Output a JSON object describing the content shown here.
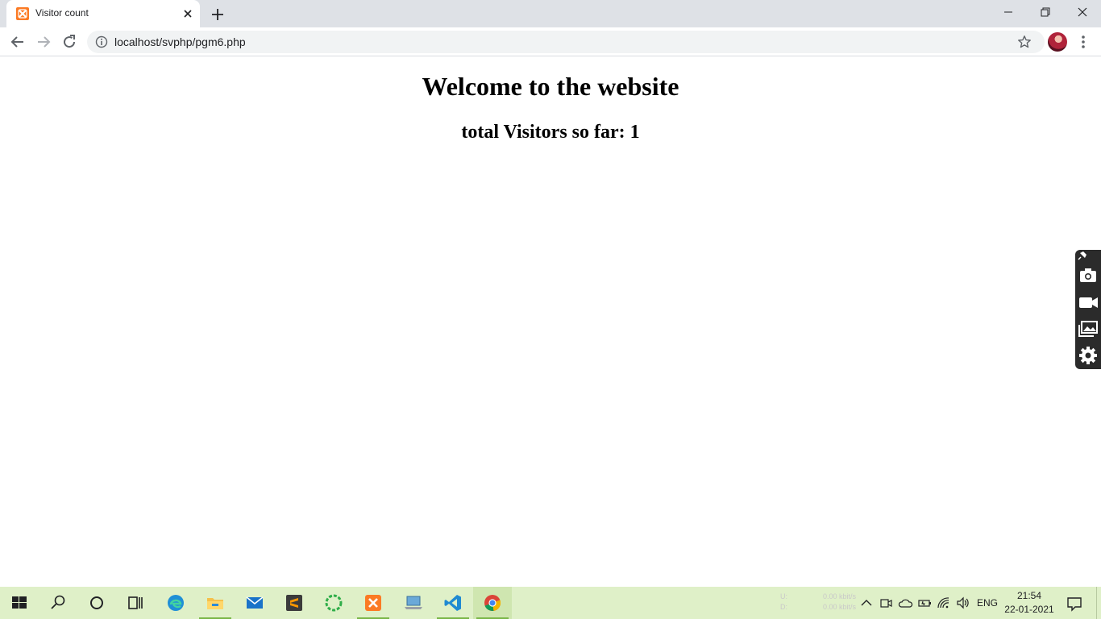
{
  "browser": {
    "tab": {
      "title": "Visitor count",
      "favicon": "xampp-icon"
    },
    "address_bar": {
      "url": "localhost/svphp/pgm6.php"
    }
  },
  "page": {
    "heading": "Welcome to the website",
    "visitor_line": "total Visitors so far: 1"
  },
  "side_widget": {
    "buttons": [
      "pin-icon",
      "camera-icon",
      "video-icon",
      "gallery-icon",
      "settings-icon"
    ]
  },
  "taskbar": {
    "apps": [
      "start-icon",
      "search-icon",
      "cortana-icon",
      "task-view-icon",
      "edge-icon",
      "file-explorer-icon",
      "mail-icon",
      "sublime-text-icon",
      "loader-app-icon",
      "xampp-icon",
      "laptop-icon",
      "vscode-icon",
      "chrome-icon"
    ],
    "network": {
      "up_label": "U:",
      "down_label": "D:",
      "up_value": "0.00 kbit/s",
      "down_value": "0.00 kbit/s"
    },
    "language": "ENG",
    "time": "21:54",
    "date": "22-01-2021",
    "colors": {
      "background": "#dff0c8",
      "running_indicator": "#7ab648"
    }
  }
}
